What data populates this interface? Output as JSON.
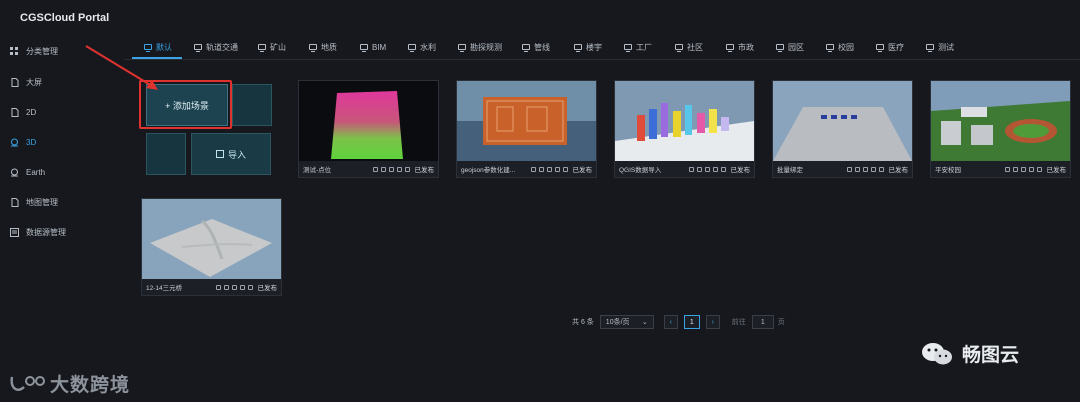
{
  "app": {
    "title": "CGSCloud Portal"
  },
  "sidebar": {
    "items": [
      {
        "label": "分类管理",
        "icon": "grid-icon",
        "active": false
      },
      {
        "label": "大屏",
        "icon": "doc-icon",
        "active": false
      },
      {
        "label": "2D",
        "icon": "doc-icon",
        "active": false
      },
      {
        "label": "3D",
        "icon": "globe-icon",
        "active": true
      },
      {
        "label": "Earth",
        "icon": "globe-icon",
        "active": false
      },
      {
        "label": "地图管理",
        "icon": "doc-icon",
        "active": false
      },
      {
        "label": "数据源管理",
        "icon": "database-icon",
        "active": false
      }
    ]
  },
  "tabs": [
    {
      "label": "默认",
      "active": true
    },
    {
      "label": "轨道交通"
    },
    {
      "label": "矿山"
    },
    {
      "label": "地质"
    },
    {
      "label": "BIM"
    },
    {
      "label": "水利"
    },
    {
      "label": "勘探规测"
    },
    {
      "label": "管线"
    },
    {
      "label": "楼宇"
    },
    {
      "label": "工厂"
    },
    {
      "label": "社区"
    },
    {
      "label": "市政"
    },
    {
      "label": "园区"
    },
    {
      "label": "校园"
    },
    {
      "label": "医疗"
    },
    {
      "label": "测试"
    }
  ],
  "actions": {
    "add_scene": "+ 添加场景",
    "import": "导入"
  },
  "cards": [
    {
      "name": "测试-点位",
      "status": "已发布"
    },
    {
      "name": "geojson参数化建...",
      "status": "已发布"
    },
    {
      "name": "QGIS数据导入",
      "status": "已发布"
    },
    {
      "name": "批量绑定",
      "status": "已发布"
    },
    {
      "name": "平安校园",
      "status": "已发布"
    },
    {
      "name": "12-14三元桥",
      "status": "已发布"
    }
  ],
  "pagination": {
    "total": "共 6 条",
    "page_size": "10条/页",
    "current": "1",
    "goto_label": "前往",
    "goto_value": "1",
    "page_suffix": "页"
  },
  "watermarks": {
    "right": "畅图云",
    "left": "大数跨境"
  },
  "colors": {
    "accent": "#3aa4e6",
    "highlight": "#e0322f",
    "background": "#16181d"
  }
}
